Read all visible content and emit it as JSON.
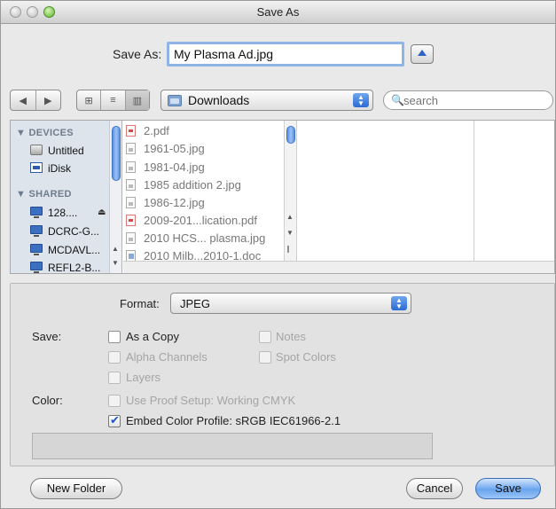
{
  "window": {
    "title": "Save As"
  },
  "save_as": {
    "label": "Save As:",
    "filename": "My Plasma Ad.jpg"
  },
  "toolbar": {
    "back_glyph": "◀",
    "forward_glyph": "▶",
    "view_icons": [
      "⊞",
      "≡",
      "▥"
    ],
    "location": "Downloads",
    "search_glyph": "🔍",
    "search_placeholder": "search"
  },
  "sidebar": {
    "devices_header": "▼ DEVICES",
    "devices": [
      {
        "label": "Untitled",
        "icon": "hard-disk-icon"
      },
      {
        "label": "iDisk",
        "icon": "idisk-icon"
      }
    ],
    "shared_header": "▼ SHARED",
    "shared": [
      {
        "label": "128....",
        "icon": "computer-icon",
        "eject": "⏏"
      },
      {
        "label": "DCRC-G...",
        "icon": "computer-icon"
      },
      {
        "label": "MCDAVL...",
        "icon": "computer-icon"
      },
      {
        "label": "REFL2-B...",
        "icon": "computer-icon"
      }
    ]
  },
  "files": [
    {
      "name": "2.pdf",
      "type": "pdf"
    },
    {
      "name": "1961-05.jpg",
      "type": "jpg"
    },
    {
      "name": "1981-04.jpg",
      "type": "jpg"
    },
    {
      "name": "1985 addition 2.jpg",
      "type": "jpg"
    },
    {
      "name": "1986-12.jpg",
      "type": "jpg"
    },
    {
      "name": "2009-201...lication.pdf",
      "type": "pdf"
    },
    {
      "name": "2010 HCS... plasma.jpg",
      "type": "jpg"
    },
    {
      "name": "2010 Milb...2010-1.doc",
      "type": "doc"
    }
  ],
  "options": {
    "format_label": "Format:",
    "format_value": "JPEG",
    "save_label": "Save:",
    "as_a_copy": "As a Copy",
    "notes": "Notes",
    "alpha_channels": "Alpha Channels",
    "spot_colors": "Spot Colors",
    "layers": "Layers",
    "color_label": "Color:",
    "use_proof_setup": "Use Proof Setup:  Working CMYK",
    "embed_color_profile": "Embed Color Profile:  sRGB IEC61966-2.1"
  },
  "buttons": {
    "new_folder": "New Folder",
    "cancel": "Cancel",
    "save": "Save"
  },
  "colors": {
    "accent": "#2c69d4",
    "focus_ring": "#8fb4e6"
  }
}
